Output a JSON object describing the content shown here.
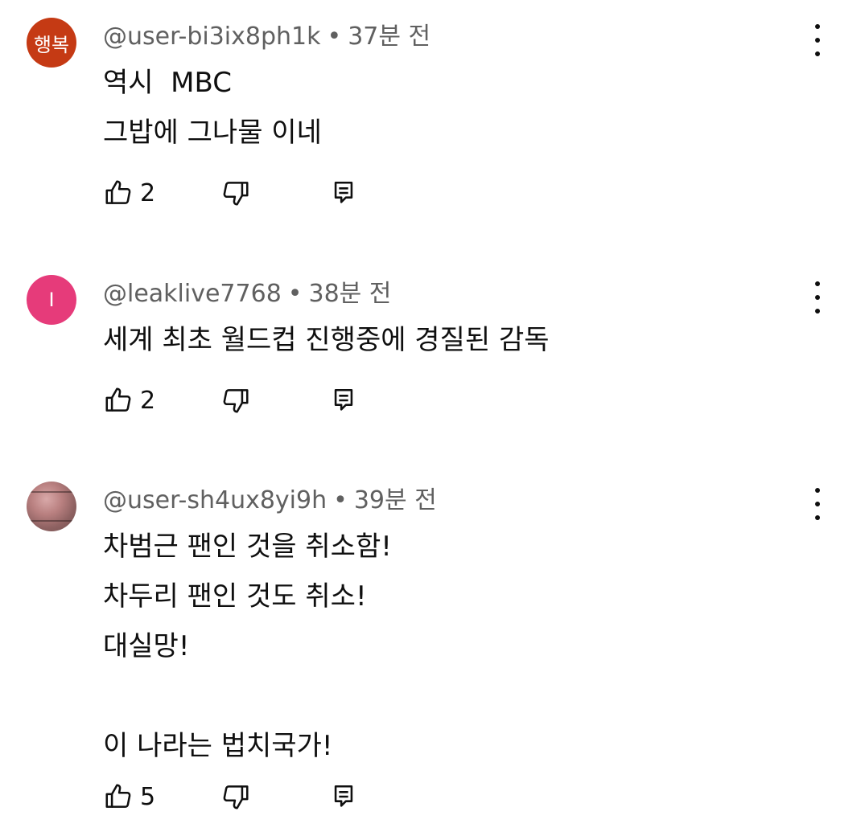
{
  "comments": [
    {
      "avatar_text": "행복",
      "avatar_color": "#c53a14",
      "username": "@user-bi3ix8ph1k",
      "separator": "•",
      "time": "37분 전",
      "text": "역시  MBC\n그밥에 그나물 이네",
      "likes": "2",
      "icons": {
        "like": "thumb-up-icon",
        "dislike": "thumb-down-icon",
        "reply": "reply-comment-icon",
        "menu": "more-vertical-icon"
      }
    },
    {
      "avatar_text": "I",
      "avatar_color": "#e63b7a",
      "username": "@leaklive7768",
      "separator": "•",
      "time": "38분 전",
      "text": "세계 최초 월드컵 진행중에 경질된 감독",
      "likes": "2",
      "icons": {
        "like": "thumb-up-icon",
        "dislike": "thumb-down-icon",
        "reply": "reply-comment-icon",
        "menu": "more-vertical-icon"
      }
    },
    {
      "avatar_text": "",
      "avatar_color": "#9b6b6b",
      "username": "@user-sh4ux8yi9h",
      "separator": "•",
      "time": "39분 전",
      "text": "차범근 팬인 것을 취소함!\n차두리 팬인 것도 취소!\n대실망!\n\n이 나라는 법치국가!",
      "likes": "5",
      "icons": {
        "like": "thumb-up-icon",
        "dislike": "thumb-down-icon",
        "reply": "reply-comment-icon",
        "menu": "more-vertical-icon"
      }
    }
  ]
}
